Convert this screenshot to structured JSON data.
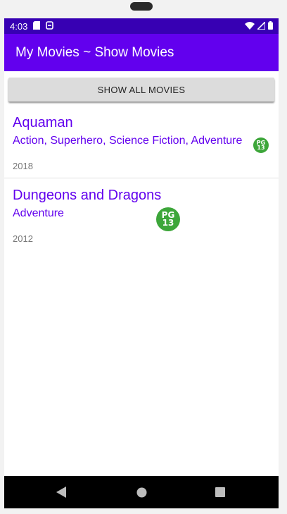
{
  "status_bar": {
    "time": "4:03",
    "left_icons": [
      "sd-card-icon",
      "notification-icon"
    ],
    "right_icons": [
      "wifi-icon",
      "signal-icon",
      "battery-icon"
    ]
  },
  "app_bar": {
    "title": "My Movies ~ Show Movies"
  },
  "show_all_button": {
    "label": "SHOW ALL MOVIES"
  },
  "movies": [
    {
      "title": "Aquaman",
      "genres": "Action, Superhero, Science Fiction, Adventure",
      "year": "2018",
      "rating": {
        "top": "PG",
        "bottom": "13"
      }
    },
    {
      "title": "Dungeons and Dragons",
      "genres": "Adventure",
      "year": "2012",
      "rating": {
        "top": "PG",
        "bottom": "13"
      }
    }
  ],
  "nav_bar": {
    "buttons": [
      "back-icon",
      "home-icon",
      "recents-icon"
    ]
  },
  "colors": {
    "status_bar": "#3700b3",
    "app_bar": "#6200ee",
    "accent_text": "#6200ee",
    "rating_badge": "#3da63a",
    "nav_bar": "#000000"
  }
}
